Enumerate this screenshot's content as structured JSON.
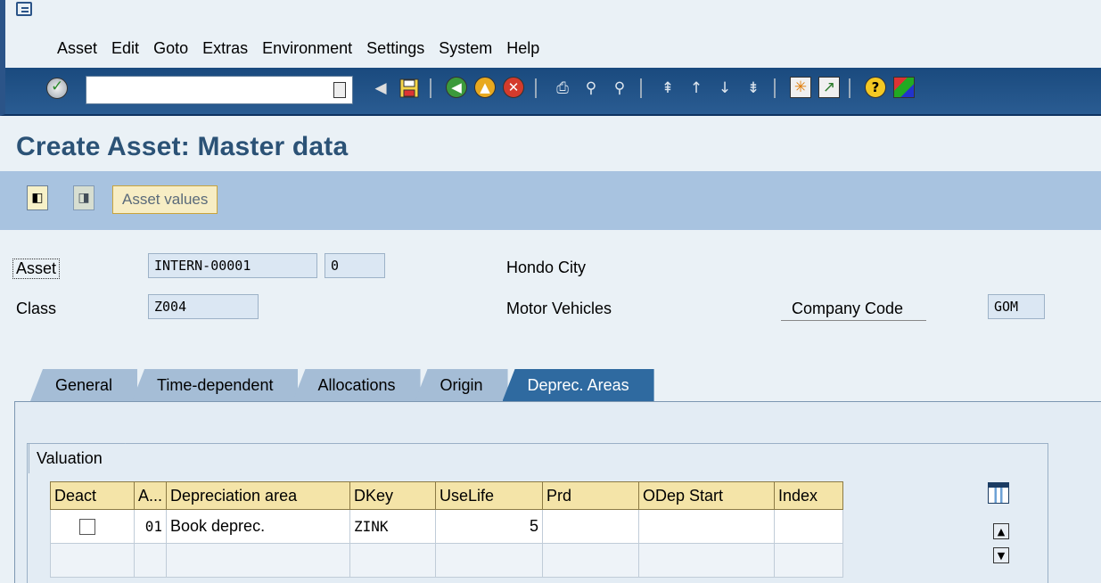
{
  "menu": {
    "items": [
      "Asset",
      "Edit",
      "Goto",
      "Extras",
      "Environment",
      "Settings",
      "System",
      "Help"
    ]
  },
  "toolbar": {
    "command_value": "",
    "icons": [
      "enter-icon",
      "dropdown-icon",
      "back-arrow-icon",
      "save-icon",
      "back-icon",
      "exit-icon",
      "cancel-icon",
      "print-icon",
      "find-icon",
      "find-next-icon",
      "first-page-icon",
      "previous-page-icon",
      "next-page-icon",
      "last-page-icon",
      "create-session-icon",
      "shortcut-icon",
      "help-icon",
      "customize-layout-icon"
    ]
  },
  "title": "Create Asset: Master data",
  "app_toolbar": {
    "asset_values_label": "Asset values"
  },
  "header": {
    "asset_label": "Asset",
    "asset_number": "INTERN-00001",
    "sub_number": "0",
    "asset_description": "Hondo  City",
    "class_label": "Class",
    "class_value": "Z004",
    "class_description": "Motor Vehicles",
    "company_code_label": "Company Code",
    "company_code_value": "GOM"
  },
  "tabs": [
    "General",
    "Time-dependent",
    "Allocations",
    "Origin",
    "Deprec. Areas"
  ],
  "active_tab": "Deprec. Areas",
  "group": {
    "title": "Valuation"
  },
  "table": {
    "columns": [
      "Deact",
      "A...",
      "Depreciation area",
      "DKey",
      "UseLife",
      "Prd",
      "ODep Start",
      "Index"
    ],
    "rows": [
      {
        "deact": "",
        "area": "01",
        "name": "Book deprec.",
        "dkey": "ZINK",
        "uselife": "5",
        "prd": "",
        "odep_start": "",
        "index": ""
      }
    ]
  },
  "colors": {
    "toolbar_bg": "#1a4a7e",
    "app_toolbar_bg": "#a8c3e0",
    "title_color": "#2b5276",
    "active_tab": "#2f6aa0",
    "table_header": "#f4e4a8"
  }
}
